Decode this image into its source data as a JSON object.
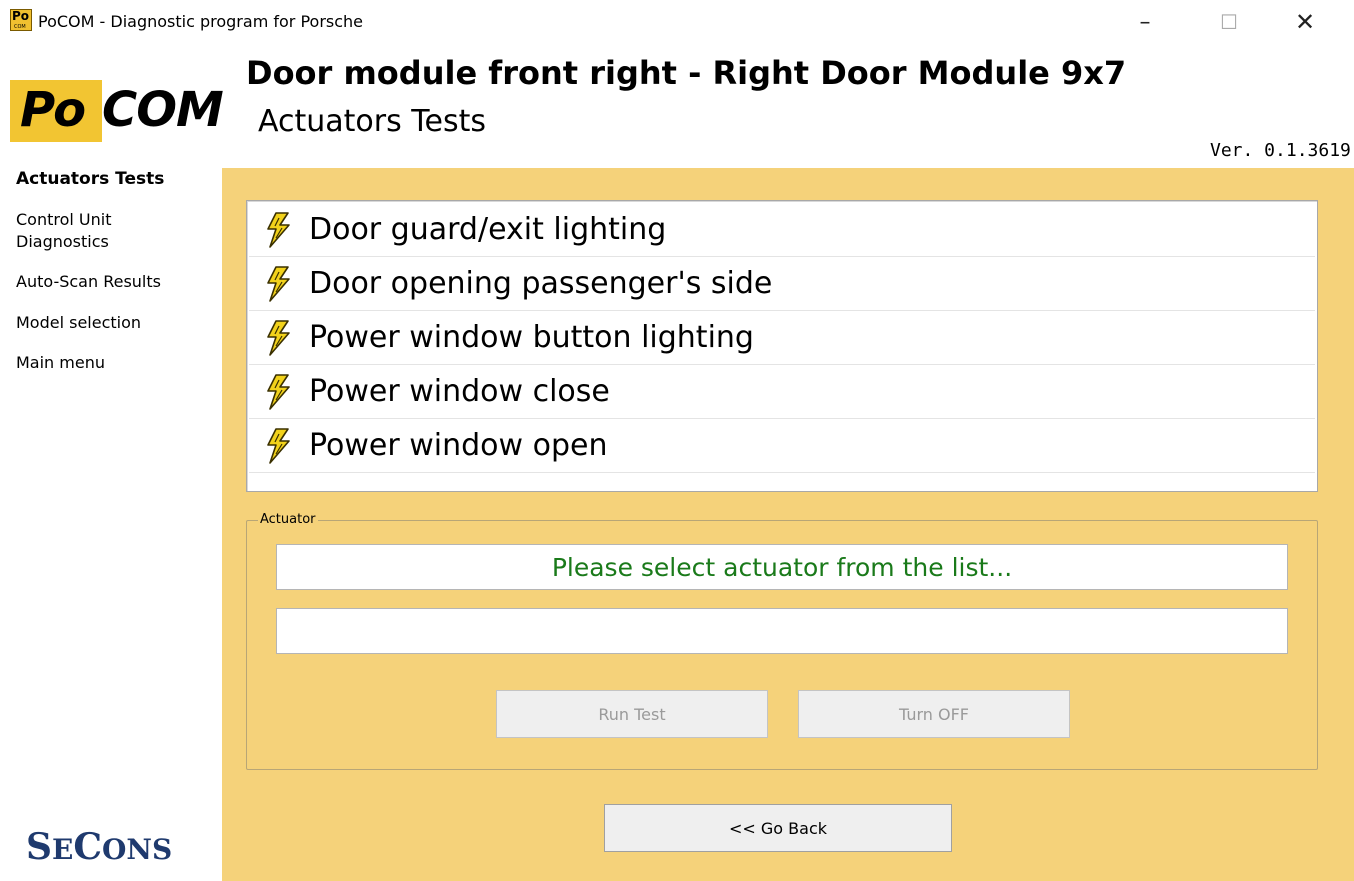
{
  "window": {
    "icon_text": "Po",
    "icon_subtext": "COM",
    "title": "PoCOM - Diagnostic program for Porsche",
    "minimize_glyph": "–",
    "maximize_glyph": "☐",
    "close_glyph": "✕"
  },
  "header": {
    "logo_po": "Po",
    "logo_com": "COM",
    "title": "Door module front right - Right Door Module 9x7",
    "subtitle": "Actuators Tests",
    "version": "Ver. 0.1.3619"
  },
  "sidebar": {
    "items": [
      {
        "label": "Actuators Tests",
        "active": true
      },
      {
        "label": "Control Unit Diagnostics",
        "active": false
      },
      {
        "label": "Auto-Scan Results",
        "active": false
      },
      {
        "label": "Model selection",
        "active": false
      },
      {
        "label": "Main menu",
        "active": false
      }
    ],
    "brand_first": "S",
    "brand_rest": "E",
    "brand_third": "C",
    "brand_last": "ONS"
  },
  "actuators": {
    "icon": "lightning-bolt-icon",
    "icon_color": "#f2d21b",
    "items": [
      {
        "label": "Door guard/exit lighting"
      },
      {
        "label": "Door opening passenger's side"
      },
      {
        "label": "Power window button lighting"
      },
      {
        "label": "Power window close"
      },
      {
        "label": "Power window open"
      }
    ]
  },
  "actuator_panel": {
    "legend": "Actuator",
    "status_text": "Please select actuator from the list...",
    "result_text": "",
    "run_label": "Run Test",
    "off_label": "Turn OFF"
  },
  "footer": {
    "back_label": "<< Go Back"
  },
  "colors": {
    "panel_bg": "#f5d27a",
    "status_green": "#1a7a1a",
    "brand_blue": "#1f3a6e",
    "logo_yellow": "#f2c532"
  }
}
